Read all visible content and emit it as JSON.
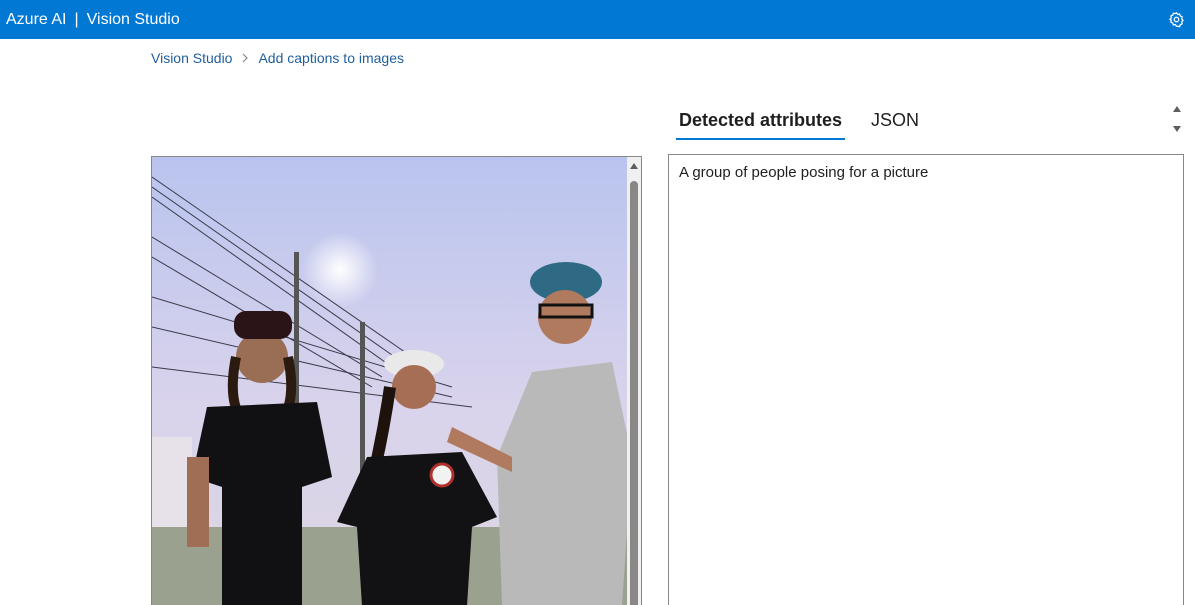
{
  "app": {
    "brand_left": "Azure AI",
    "separator": "|",
    "brand_right": "Vision Studio",
    "settings_icon": "gear-icon",
    "header_color": "#0078d4"
  },
  "breadcrumb": {
    "root": "Vision Studio",
    "current": "Add captions to images",
    "separator_icon": "chevron-right-icon"
  },
  "tabs": [
    {
      "label": "Detected attributes",
      "active": true
    },
    {
      "label": "JSON",
      "active": false
    }
  ],
  "result": {
    "caption": "A group of people posing for a picture"
  }
}
